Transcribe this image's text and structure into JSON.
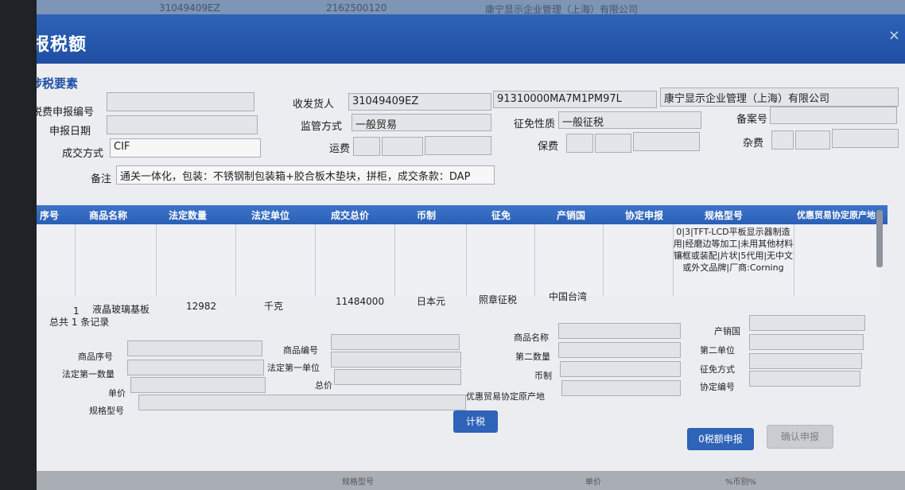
{
  "background": {
    "code1": "31049409EZ",
    "code2": "2162500120",
    "company": "康宁显示企业管理（上海）有限公司",
    "bottom_label": "规格型号",
    "bottom_label2": "单价",
    "bottom_label3": "%币别%"
  },
  "dialog": {
    "title": "报税额",
    "close_glyph": "×",
    "section_title": "涉税要素"
  },
  "form": {
    "tax_declaration_no": {
      "label": "税费申报编号",
      "value": ""
    },
    "consignee": {
      "label": "收发货人",
      "value": "31049409EZ"
    },
    "consignee_credit_code": "91310000MA7M1PM97L",
    "consignee_name": "康宁显示企业管理（上海）有限公司",
    "declare_date": {
      "label": "申报日期",
      "value": ""
    },
    "supervision_mode": {
      "label": "监管方式",
      "value": "一般贸易"
    },
    "levy_nature": {
      "label": "征免性质",
      "value": "一般征税"
    },
    "record_no": {
      "label": "备案号",
      "value": ""
    },
    "transaction_mode": {
      "label": "成交方式",
      "value": "CIF"
    },
    "freight": {
      "label": "运费"
    },
    "insurance": {
      "label": "保费"
    },
    "misc_fee": {
      "label": "杂费"
    },
    "remark": {
      "label": "备注",
      "value": "通关一体化，包装：不锈钢制包装箱+胶合板木垫块，拼柜，成交条款：DAP"
    }
  },
  "table": {
    "headers": [
      "序号",
      "商品名称",
      "法定数量",
      "法定单位",
      "成交总价",
      "币制",
      "征免",
      "产销国",
      "协定申报",
      "规格型号",
      "优惠贸易协定原产地"
    ],
    "rows": [
      {
        "no": "1",
        "name": "液晶玻璃基板",
        "qty": "12982",
        "unit": "千克",
        "total": "11484000",
        "currency": "日本元",
        "levy": "照章征税",
        "country": "中国台湾",
        "agreement": "",
        "spec": "0|3|TFT-LCD平板显示器制造用|经磨边等加工|未用其他材料镶框或装配|片状|5代用|无中文或外文品牌|厂商:Corning"
      }
    ]
  },
  "records_text": "总共 1 条记录",
  "detail": {
    "item_no": "商品序号",
    "item_code": "商品编号",
    "item_name": "商品名称",
    "origin_country": "产销国",
    "legal_qty1": "法定第一数量",
    "legal_unit1": "法定第一单位",
    "second_qty": "第二数量",
    "second_unit": "第二单位",
    "unit_price": "单价",
    "total_price": "总价",
    "currency": "币制",
    "levy_mode": "征免方式",
    "spec_model": "规格型号",
    "pref_origin": "优惠贸易协定原产地",
    "agreement_no": "协定编号"
  },
  "buttons": {
    "calc_tax": "计税",
    "zero_tax_declare": "0税额申报",
    "confirm_declare": "确认申报"
  }
}
